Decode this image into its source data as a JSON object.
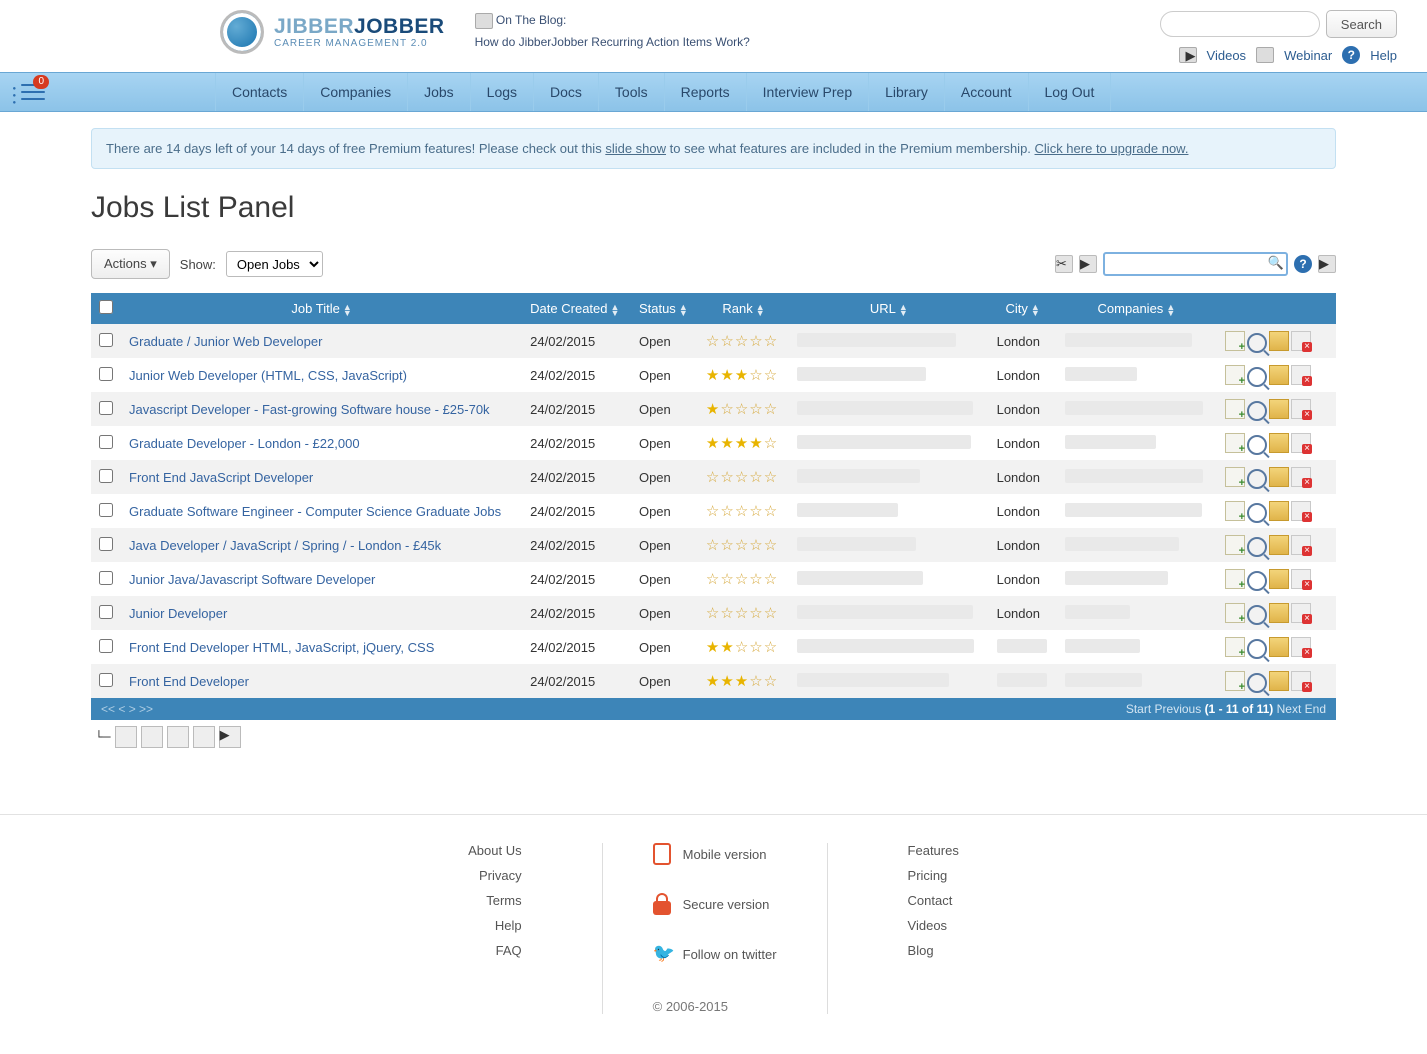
{
  "header": {
    "logo_top_a": "JIBBER",
    "logo_top_b": "JOBBER",
    "logo_sub": "CAREER MANAGEMENT 2.0",
    "blog_label": "On The Blog:",
    "blog_link": "How do JibberJobber Recurring Action Items Work?",
    "search_button": "Search",
    "videos": "Videos",
    "webinar": "Webinar",
    "help": "Help"
  },
  "nav": {
    "badge": "0",
    "items": [
      "Contacts",
      "Companies",
      "Jobs",
      "Logs",
      "Docs",
      "Tools",
      "Reports",
      "Interview Prep",
      "Library",
      "Account",
      "Log Out"
    ]
  },
  "alert": {
    "pre": "There are 14 days left of your 14 days of free Premium features! Please check out this ",
    "link1": "slide show",
    "mid": " to see what features are included in the Premium membership. ",
    "link2": "Click here to upgrade now."
  },
  "page_title": "Jobs List Panel",
  "toolbar": {
    "actions": "Actions",
    "show_label": "Show:",
    "show_value": "Open Jobs"
  },
  "columns": [
    "Job Title",
    "Date Created",
    "Status",
    "Rank",
    "URL",
    "City",
    "Companies"
  ],
  "rows": [
    {
      "title": "Graduate / Junior Web Developer",
      "date": "24/02/2015",
      "status": "Open",
      "rank": 0,
      "city": "London"
    },
    {
      "title": "Junior Web Developer (HTML, CSS, JavaScript)",
      "date": "24/02/2015",
      "status": "Open",
      "rank": 3,
      "city": "London"
    },
    {
      "title": "Javascript Developer - Fast-growing Software house - £25-70k",
      "date": "24/02/2015",
      "status": "Open",
      "rank": 1,
      "city": "London"
    },
    {
      "title": "Graduate Developer - London - £22,000",
      "date": "24/02/2015",
      "status": "Open",
      "rank": 4,
      "city": "London"
    },
    {
      "title": "Front End JavaScript Developer",
      "date": "24/02/2015",
      "status": "Open",
      "rank": 0,
      "city": "London"
    },
    {
      "title": "Graduate Software Engineer - Computer Science Graduate Jobs",
      "date": "24/02/2015",
      "status": "Open",
      "rank": 0,
      "city": "London"
    },
    {
      "title": "Java Developer / JavaScript / Spring / - London - £45k",
      "date": "24/02/2015",
      "status": "Open",
      "rank": 0,
      "city": "London"
    },
    {
      "title": "Junior Java/Javascript Software Developer",
      "date": "24/02/2015",
      "status": "Open",
      "rank": 0,
      "city": "London"
    },
    {
      "title": "Junior Developer",
      "date": "24/02/2015",
      "status": "Open",
      "rank": 0,
      "city": "London"
    },
    {
      "title": "Front End Developer HTML, JavaScript, jQuery, CSS",
      "date": "24/02/2015",
      "status": "Open",
      "rank": 2,
      "city": ""
    },
    {
      "title": "Front End Developer",
      "date": "24/02/2015",
      "status": "Open",
      "rank": 3,
      "city": ""
    }
  ],
  "pager": {
    "arrows": "<< < > >>",
    "start": "Start",
    "prev": "Previous",
    "range": "(1 - 11 of 11)",
    "next": "Next",
    "end": "End"
  },
  "footer": {
    "col1": [
      "About Us",
      "Privacy",
      "Terms",
      "Help",
      "FAQ"
    ],
    "mobile": "Mobile version",
    "secure": "Secure version",
    "twitter": "Follow on twitter",
    "copyright": "© 2006-2015",
    "col3": [
      "Features",
      "Pricing",
      "Contact",
      "Videos",
      "Blog"
    ]
  }
}
